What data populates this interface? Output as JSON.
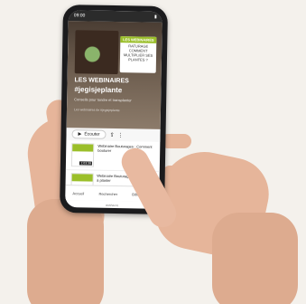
{
  "status": {
    "time": "09:00",
    "battery": "100"
  },
  "hero": {
    "card_label": "LES WEBINAIRES",
    "card_text": "RATURAGE COMMENT MULTIPLIER SES PLANTES ?",
    "title": "LES WEBINAIRES",
    "tag": "#jegisjeplante",
    "subtitle": "Conseils pour tondre et transplanter",
    "description": "Les webinaires de #jegisjeplante",
    "play_label": "Écouter"
  },
  "episodes": [
    {
      "title": "Webinaire Bouturages : Comment bouturer",
      "duration": "1:03:38"
    },
    {
      "title": "Webinaire Bouturages : J'apprends à planter",
      "duration": "1:02:24"
    }
  ],
  "nav": {
    "home": "Accueil",
    "search": "Rechercher",
    "library": "Bibliothèque"
  },
  "url": "ausha.co"
}
